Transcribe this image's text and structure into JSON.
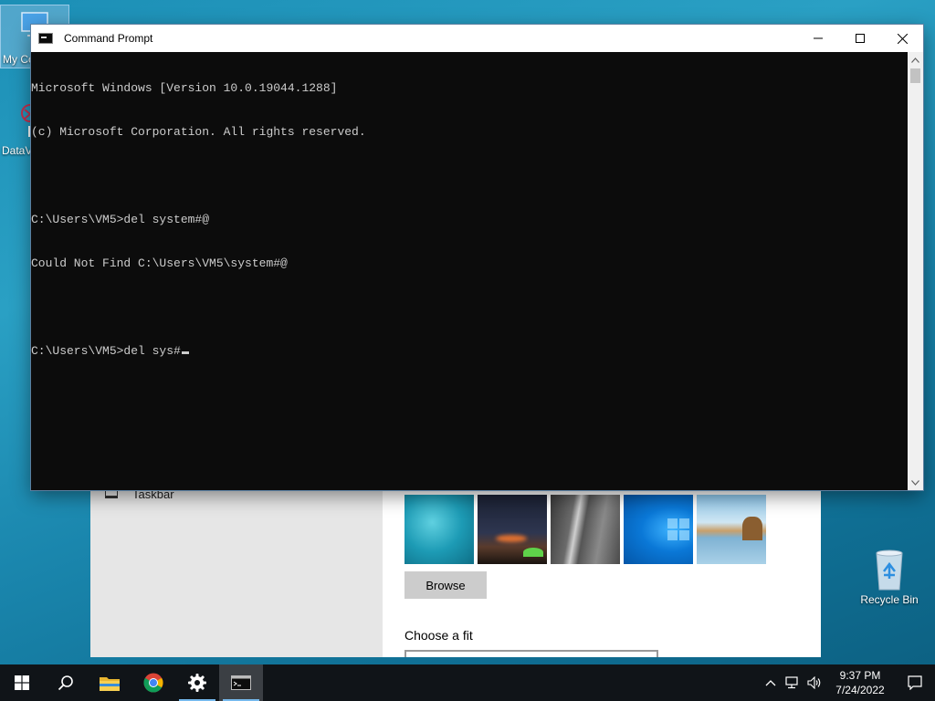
{
  "desktop": {
    "icons": [
      {
        "label": "My Co",
        "name": "my-computer"
      },
      {
        "label": "DataV",
        "name": "datav-shortcut"
      },
      {
        "label": "Recycle Bin",
        "name": "recycle-bin"
      }
    ]
  },
  "settings": {
    "nav_item_label": "Taskbar",
    "browse_label": "Browse",
    "choose_fit_label": "Choose a fit",
    "thumbnails": [
      "underwater-swimmer",
      "night-sky-tent",
      "rock-cliff",
      "windows-logo-blue",
      "beach-rocks"
    ]
  },
  "cmd": {
    "title": "Command Prompt",
    "lines": [
      "Microsoft Windows [Version 10.0.19044.1288]",
      "(c) Microsoft Corporation. All rights reserved.",
      "",
      "C:\\Users\\VM5>del system#@",
      "Could Not Find C:\\Users\\VM5\\system#@",
      "",
      "C:\\Users\\VM5>del sys#"
    ],
    "colors": {
      "background": "#0c0c0c",
      "text": "#cccccc"
    }
  },
  "taskbar": {
    "apps": [
      "start",
      "search",
      "file-explorer",
      "chrome",
      "settings",
      "command-prompt"
    ],
    "active_app": "command-prompt",
    "time": "9:37 PM",
    "date": "7/24/2022"
  }
}
